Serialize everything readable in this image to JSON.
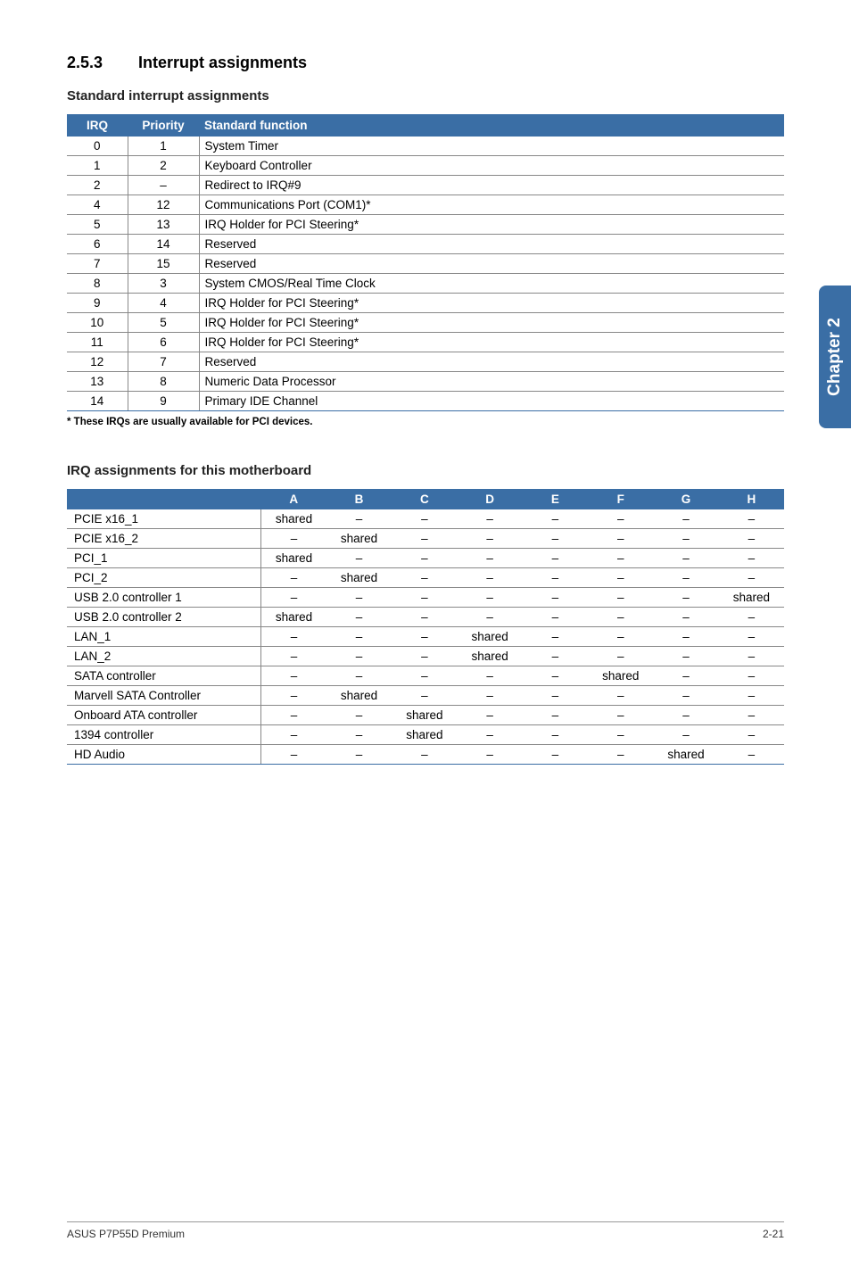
{
  "section": {
    "number": "2.5.3",
    "title": "Interrupt assignments"
  },
  "std": {
    "heading": "Standard interrupt assignments",
    "th": {
      "irq": "IRQ",
      "priority": "Priority",
      "fn": "Standard function"
    },
    "rows": [
      {
        "irq": "0",
        "pri": "1",
        "fn": "System Timer"
      },
      {
        "irq": "1",
        "pri": "2",
        "fn": "Keyboard Controller"
      },
      {
        "irq": "2",
        "pri": "–",
        "fn": "Redirect to IRQ#9"
      },
      {
        "irq": "4",
        "pri": "12",
        "fn": "Communications Port (COM1)*"
      },
      {
        "irq": "5",
        "pri": "13",
        "fn": "IRQ Holder for PCI Steering*"
      },
      {
        "irq": "6",
        "pri": "14",
        "fn": "Reserved"
      },
      {
        "irq": "7",
        "pri": "15",
        "fn": "Reserved"
      },
      {
        "irq": "8",
        "pri": "3",
        "fn": "System CMOS/Real Time Clock"
      },
      {
        "irq": "9",
        "pri": "4",
        "fn": "IRQ Holder for PCI Steering*"
      },
      {
        "irq": "10",
        "pri": "5",
        "fn": "IRQ Holder for PCI Steering*"
      },
      {
        "irq": "11",
        "pri": "6",
        "fn": "IRQ Holder for PCI Steering*"
      },
      {
        "irq": "12",
        "pri": "7",
        "fn": "Reserved"
      },
      {
        "irq": "13",
        "pri": "8",
        "fn": "Numeric Data Processor"
      },
      {
        "irq": "14",
        "pri": "9",
        "fn": "Primary IDE Channel"
      }
    ],
    "footnote": "* These IRQs are usually available for PCI devices."
  },
  "mb": {
    "heading": "IRQ assignments for this motherboard",
    "cols": [
      "A",
      "B",
      "C",
      "D",
      "E",
      "F",
      "G",
      "H"
    ],
    "blank_header": "",
    "rows": [
      {
        "label": "PCIE x16_1",
        "cells": [
          "shared",
          "–",
          "–",
          "–",
          "–",
          "–",
          "–",
          "–"
        ]
      },
      {
        "label": "PCIE x16_2",
        "cells": [
          "–",
          "shared",
          "–",
          "–",
          "–",
          "–",
          "–",
          "–"
        ]
      },
      {
        "label": "PCI_1",
        "cells": [
          "shared",
          "–",
          "–",
          "–",
          "–",
          "–",
          "–",
          "–"
        ]
      },
      {
        "label": "PCI_2",
        "cells": [
          "–",
          "shared",
          "–",
          "–",
          "–",
          "–",
          "–",
          "–"
        ]
      },
      {
        "label": "USB 2.0 controller 1",
        "cells": [
          "–",
          "–",
          "–",
          "–",
          "–",
          "–",
          "–",
          "shared"
        ]
      },
      {
        "label": "USB 2.0 controller 2",
        "cells": [
          "shared",
          "–",
          "–",
          "–",
          "–",
          "–",
          "–",
          "–"
        ]
      },
      {
        "label": "LAN_1",
        "cells": [
          "–",
          "–",
          "–",
          "shared",
          "–",
          "–",
          "–",
          "–"
        ]
      },
      {
        "label": "LAN_2",
        "cells": [
          "–",
          "–",
          "–",
          "shared",
          "–",
          "–",
          "–",
          "–"
        ]
      },
      {
        "label": "SATA controller",
        "cells": [
          "–",
          "–",
          "–",
          "–",
          "–",
          "shared",
          "–",
          "–"
        ]
      },
      {
        "label": "Marvell SATA Controller",
        "cells": [
          "–",
          "shared",
          "–",
          "–",
          "–",
          "–",
          "–",
          "–"
        ]
      },
      {
        "label": "Onboard ATA controller",
        "cells": [
          "–",
          "–",
          "shared",
          "–",
          "–",
          "–",
          "–",
          "–"
        ]
      },
      {
        "label": "1394 controller",
        "cells": [
          "–",
          "–",
          "shared",
          "–",
          "–",
          "–",
          "–",
          "–"
        ]
      },
      {
        "label": "HD Audio",
        "cells": [
          "–",
          "–",
          "–",
          "–",
          "–",
          "–",
          "shared",
          "–"
        ]
      }
    ]
  },
  "sidetab": "Chapter 2",
  "footer": {
    "left": "ASUS P7P55D Premium",
    "right": "2-21"
  }
}
